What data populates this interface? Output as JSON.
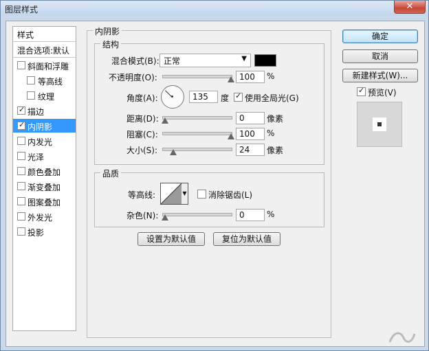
{
  "window": {
    "title": "图层样式",
    "close_glyph": "✕"
  },
  "styles": {
    "header": "样式",
    "blending_default": "混合选项:默认",
    "items": [
      {
        "label": "斜面和浮雕",
        "checked": false
      },
      {
        "label": "等高线",
        "checked": false
      },
      {
        "label": "纹理",
        "checked": false
      },
      {
        "label": "描边",
        "checked": true
      },
      {
        "label": "内阴影",
        "checked": true,
        "selected": true
      },
      {
        "label": "内发光",
        "checked": false
      },
      {
        "label": "光泽",
        "checked": false
      },
      {
        "label": "颜色叠加",
        "checked": false
      },
      {
        "label": "渐变叠加",
        "checked": false
      },
      {
        "label": "图案叠加",
        "checked": false
      },
      {
        "label": "外发光",
        "checked": false
      },
      {
        "label": "投影",
        "checked": false
      }
    ]
  },
  "inner_shadow": {
    "section_title": "内阴影",
    "structure": {
      "title": "结构",
      "blend_mode_label": "混合模式(B):",
      "blend_mode_value": "正常",
      "shadow_color": "#000000",
      "opacity_label": "不透明度(O):",
      "opacity_value": "100",
      "opacity_unit": "%",
      "angle_label": "角度(A):",
      "angle_value": "135",
      "angle_unit": "度",
      "global_light_label": "使用全局光(G)",
      "global_light_checked": true,
      "distance_label": "距离(D):",
      "distance_value": "0",
      "distance_unit": "像素",
      "choke_label": "阻塞(C):",
      "choke_value": "100",
      "choke_unit": "%",
      "size_label": "大小(S):",
      "size_value": "24",
      "size_unit": "像素"
    },
    "quality": {
      "title": "品质",
      "contour_label": "等高线:",
      "anti_alias_label": "消除锯齿(L)",
      "anti_alias_checked": false,
      "noise_label": "杂色(N):",
      "noise_value": "0",
      "noise_unit": "%"
    },
    "set_default_button": "设置为默认值",
    "reset_default_button": "复位为默认值"
  },
  "actions": {
    "ok_button": "确定",
    "cancel_button": "取消",
    "new_style_button": "新建样式(W)...",
    "preview_label": "预览(V)",
    "preview_checked": true
  },
  "check_glyph": "✓",
  "dropdown_glyph": "▼",
  "icons": [
    "close-icon",
    "checkbox-icon",
    "dropdown-arrow-icon",
    "angle-dial-icon",
    "contour-curve-icon",
    "watermark-icon"
  ]
}
